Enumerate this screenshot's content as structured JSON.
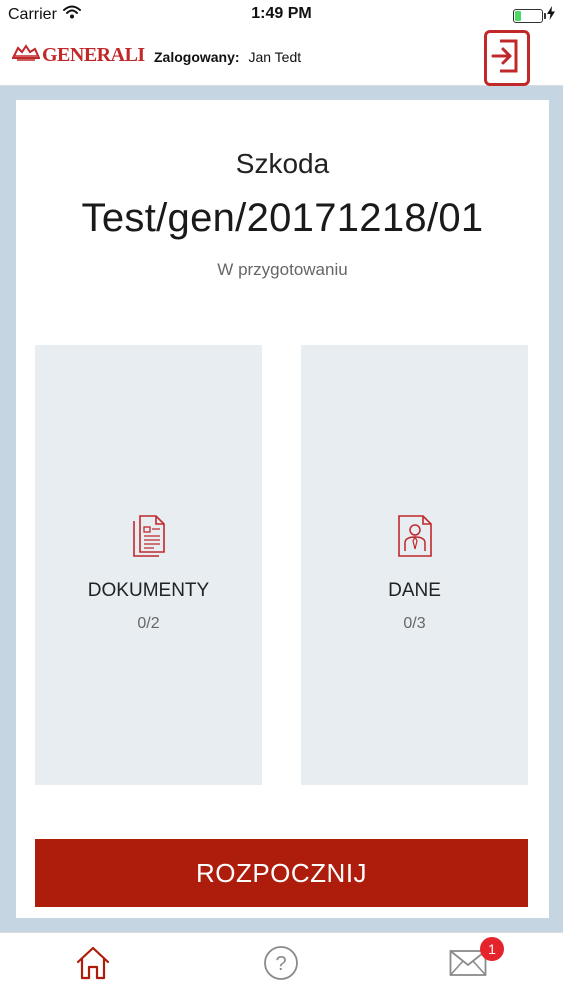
{
  "status_bar": {
    "carrier": "Carrier",
    "time": "1:49 PM"
  },
  "header": {
    "brand": "GENERALI",
    "logged_in_label": "Zalogowany:",
    "user_name": "Jan Tedt"
  },
  "claim": {
    "type": "Szkoda",
    "number": "Test/gen/20171218/01",
    "status": "W przygotowaniu"
  },
  "tiles": [
    {
      "title": "DOKUMENTY",
      "count": "0/2",
      "icon": "documents-icon"
    },
    {
      "title": "DANE",
      "count": "0/3",
      "icon": "person-data-icon"
    }
  ],
  "start_button": {
    "label": "ROZPOCZNIJ"
  },
  "tab_bar": {
    "items": [
      {
        "icon": "home-icon"
      },
      {
        "icon": "help-icon",
        "glyph": "?"
      },
      {
        "icon": "mail-icon"
      }
    ],
    "messages_badge": "1"
  },
  "colors": {
    "brand_red": "#c0282a",
    "button_red": "#ae1c0c",
    "frame_blue": "#c5d5e2",
    "tile_gray": "#e8edf2",
    "badge_red": "#e5232b",
    "battery_green": "#4cd964"
  }
}
